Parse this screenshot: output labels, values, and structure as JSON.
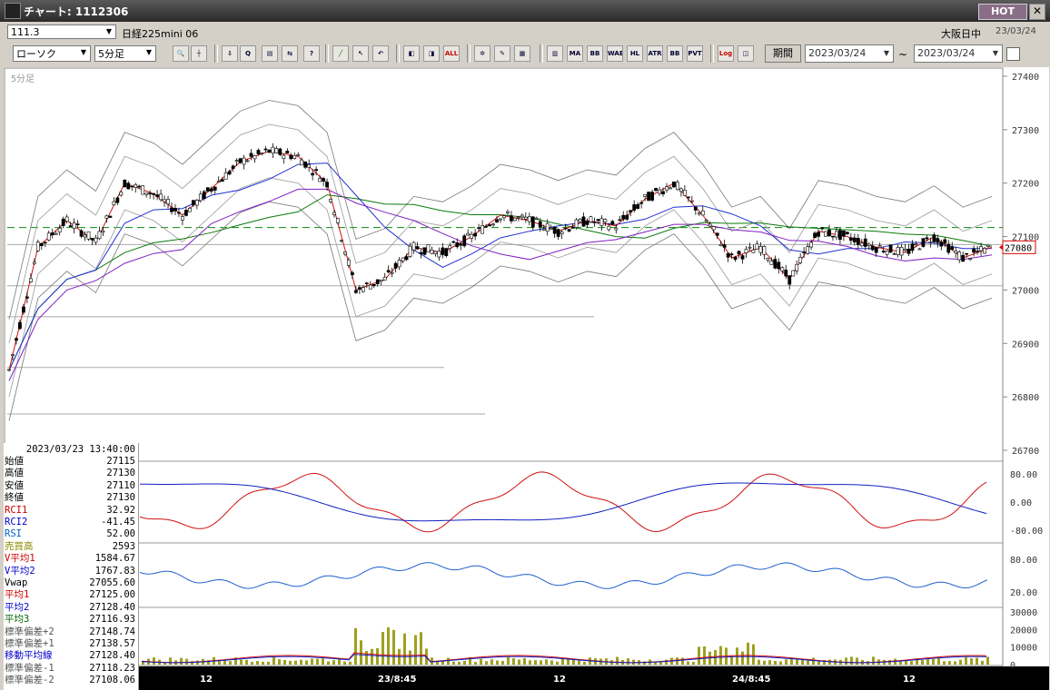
{
  "window": {
    "title": "チャート: 1112306",
    "hot_label": "HOT",
    "close_label": "✕"
  },
  "header": {
    "code": "111.3",
    "instrument": "日経225mini 06",
    "market": "大阪日中",
    "date": "23/03/24"
  },
  "toolbar": {
    "chart_type": "ローソク",
    "interval": "5分足",
    "period_label": "期間",
    "from_date": "2023/03/24",
    "to_date": "2023/03/24",
    "range_sep": "~",
    "buttons": [
      "MA",
      "BB",
      "WAE",
      "HL",
      "ATR",
      "BB",
      "PVT",
      "Log"
    ],
    "all_label": "ALL"
  },
  "chart": {
    "interval_label": "5分足",
    "price_axis": [
      "27400",
      "27300",
      "27200",
      "27100",
      "27000",
      "26900",
      "26800",
      "26700"
    ],
    "last_price": "27080",
    "osc_axis": [
      "80.00",
      "0.00",
      "-80.00"
    ],
    "rsi_axis": [
      "80.00",
      "20.00"
    ],
    "vol_axis": [
      "30000",
      "20000",
      "10000",
      "0"
    ],
    "time_axis": [
      "12",
      "23/8:45",
      "12",
      "24/8:45",
      "12"
    ]
  },
  "info_panel": {
    "datetime": "2023/03/23 13:40:00",
    "rows": [
      {
        "k": "始値",
        "v": "27115",
        "c": "#000"
      },
      {
        "k": "高値",
        "v": "27130",
        "c": "#000"
      },
      {
        "k": "安値",
        "v": "27110",
        "c": "#000"
      },
      {
        "k": "終値",
        "v": "27130",
        "c": "#000"
      },
      {
        "k": "RCI1",
        "v": "32.92",
        "c": "#c00"
      },
      {
        "k": "RCI2",
        "v": "-41.45",
        "c": "#00c"
      },
      {
        "k": "RSI",
        "v": "52.00",
        "c": "#06c"
      },
      {
        "k": "売買高",
        "v": "2593",
        "c": "#8a8a00"
      },
      {
        "k": "V平均1",
        "v": "1584.67",
        "c": "#c00"
      },
      {
        "k": "V平均2",
        "v": "1767.83",
        "c": "#00c"
      },
      {
        "k": "Vwap",
        "v": "27055.60",
        "c": "#000"
      },
      {
        "k": "平均1",
        "v": "27125.00",
        "c": "#c00"
      },
      {
        "k": "平均2",
        "v": "27128.40",
        "c": "#00c"
      },
      {
        "k": "平均3",
        "v": "27116.93",
        "c": "#060"
      },
      {
        "k": "標準偏差+2",
        "v": "27148.74",
        "c": "#555"
      },
      {
        "k": "標準偏差+1",
        "v": "27138.57",
        "c": "#555"
      },
      {
        "k": "移動平均線",
        "v": "27128.40",
        "c": "#00c"
      },
      {
        "k": "標準偏差-1",
        "v": "27118.23",
        "c": "#555"
      },
      {
        "k": "標準偏差-2",
        "v": "27108.06",
        "c": "#555"
      }
    ]
  },
  "chart_data": {
    "type": "line",
    "series": [
      {
        "name": "終値",
        "values": [
          26850,
          27080,
          27130,
          27090,
          27200,
          27180,
          27140,
          27190,
          27240,
          27260,
          27250,
          27200,
          27000,
          27020,
          27080,
          27070,
          27100,
          27140,
          27130,
          27110,
          27130,
          27120,
          27170,
          27200,
          27140,
          27060,
          27080,
          27020,
          27110,
          27100,
          27080,
          27070,
          27100,
          27060,
          27080
        ]
      }
    ],
    "ylim": [
      26700,
      27400
    ]
  }
}
